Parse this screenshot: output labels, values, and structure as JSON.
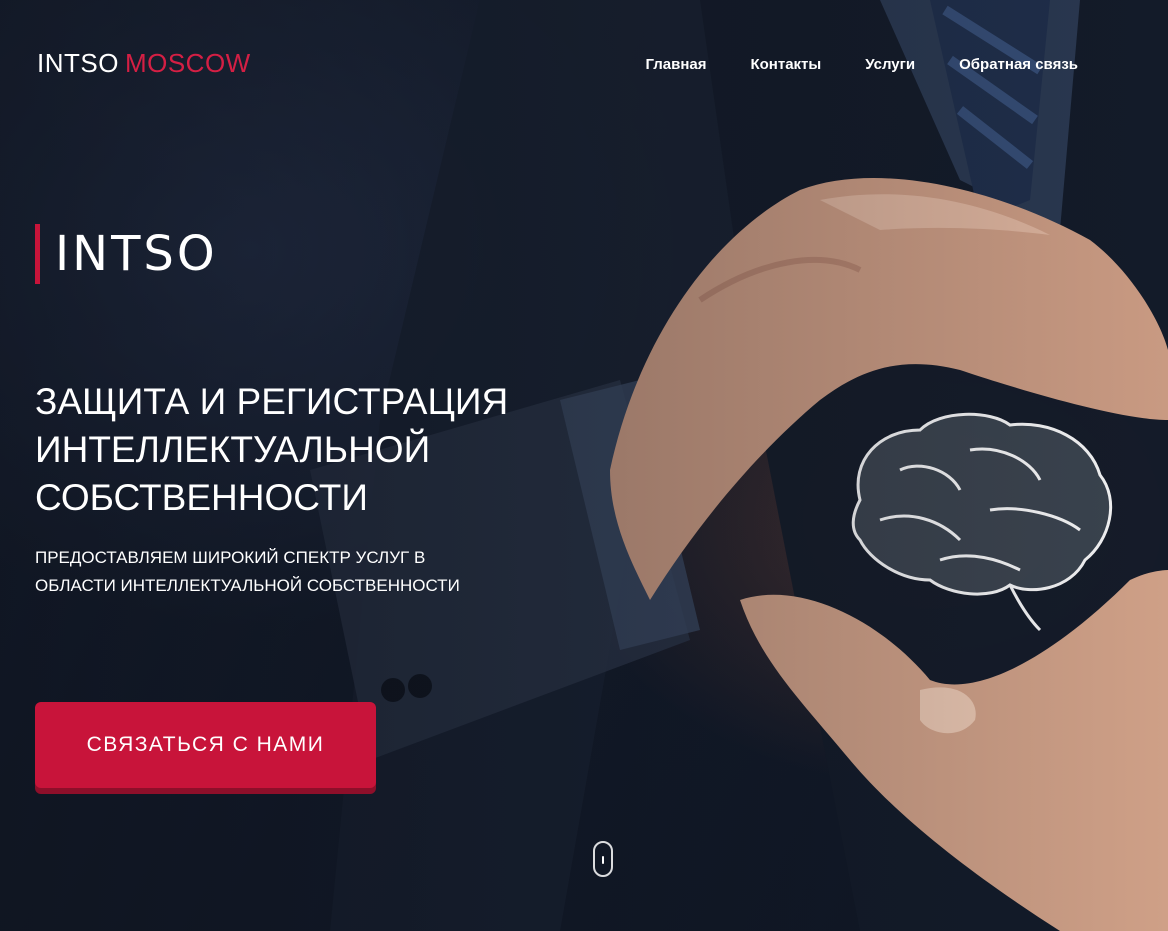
{
  "header": {
    "logo_part1": "INTSO",
    "logo_part2": "MOSCOW",
    "nav": [
      {
        "label": "Главная"
      },
      {
        "label": "Контакты"
      },
      {
        "label": "Услуги"
      },
      {
        "label": "Обратная связь"
      }
    ]
  },
  "hero": {
    "brand": "INTSO",
    "headline_lines": [
      "ЗАЩИТА И РЕГИСТРАЦИЯ",
      "ИНТЕЛЛЕКТУАЛЬНОЙ",
      "СОБСТВЕННОСТИ"
    ],
    "subline_lines": [
      "ПРЕДОСТАВЛЯЕМ ШИРОКИЙ СПЕКТР УСЛУГ В",
      "ОБЛАСТИ ИНТЕЛЛЕКТУАЛЬНОЙ СОБСТВЕННОСТИ"
    ],
    "cta_label": "СВЯЗАТЬСЯ С НАМИ",
    "scroll_icon": "mouse-scroll-icon"
  },
  "colors": {
    "accent": "#c8143a",
    "logo_accent": "#d41f44",
    "background": "#141c2b",
    "text": "#ffffff"
  }
}
